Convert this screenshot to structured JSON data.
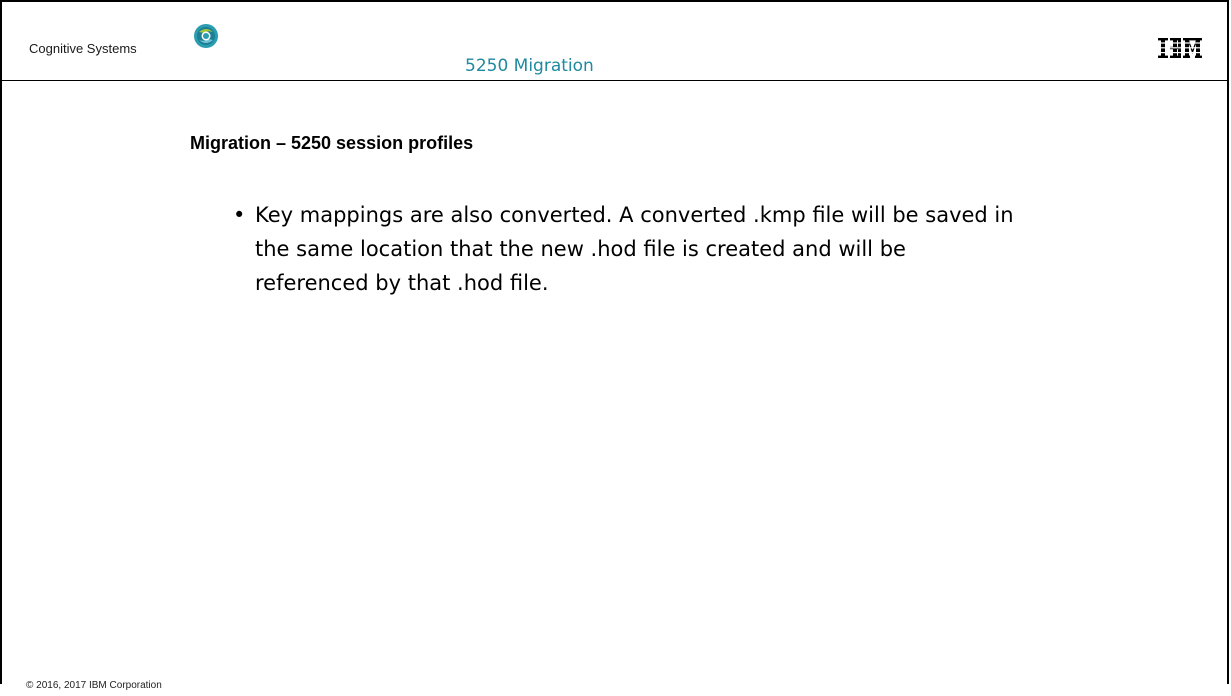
{
  "header": {
    "brand_text": "Cognitive Systems",
    "brand_logo_icon": "circular-swirl-logo-icon",
    "deck_title": "5250 Migration",
    "vendor_logo_icon": "ibm-logo-icon",
    "vendor_logo_text": "IBM"
  },
  "slide": {
    "heading": "Migration – 5250 session profiles",
    "bullets": [
      {
        "marker": "•",
        "text": "Key mappings are also converted. A converted .kmp file will be saved in the same location that the new .hod file is created and will be referenced by that .hod file."
      }
    ]
  },
  "footer": {
    "copyright": "© 2016, 2017 IBM Corporation"
  },
  "colors": {
    "deck_title": "#1f8aa0",
    "logo_outer": "#2a9db0",
    "logo_accent": "#a3c83b",
    "frame": "#000000"
  }
}
